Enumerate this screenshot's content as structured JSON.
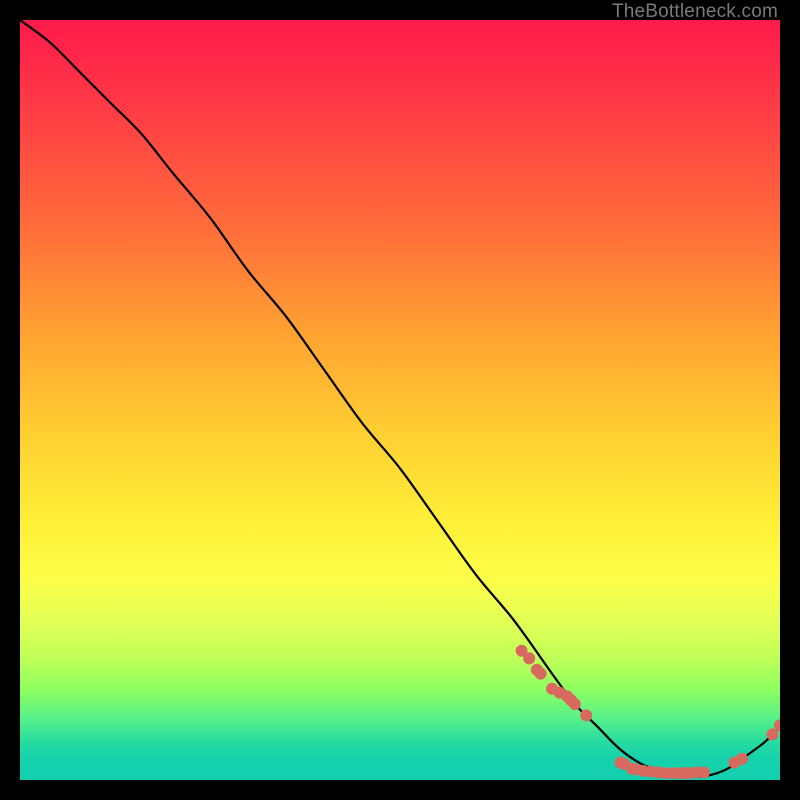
{
  "watermark": "TheBottleneck.com",
  "chart_data": {
    "type": "line",
    "title": "",
    "xlabel": "",
    "ylabel": "",
    "xlim": [
      0,
      100
    ],
    "ylim": [
      0,
      100
    ],
    "grid": false,
    "curve": {
      "name": "bottleneck-curve",
      "color": "#000000",
      "x": [
        0,
        4,
        8,
        12,
        16,
        20,
        25,
        30,
        35,
        40,
        45,
        50,
        55,
        60,
        65,
        70,
        73,
        76,
        79,
        82,
        85,
        88,
        90,
        92,
        94,
        96,
        98,
        100
      ],
      "y": [
        100,
        97,
        93,
        89,
        85,
        80,
        74,
        67,
        61,
        54,
        47,
        41,
        34,
        27,
        21,
        14,
        10,
        7,
        4,
        2,
        1,
        0.5,
        0.5,
        1,
        2,
        3.5,
        5,
        7
      ]
    },
    "points": {
      "name": "sample-points",
      "color": "#d8695f",
      "radius_px": 6,
      "x": [
        66,
        67,
        68,
        68.5,
        70,
        71,
        72,
        72.5,
        73,
        74.5,
        79,
        79.5,
        80.5,
        81,
        82,
        83,
        84,
        85,
        86,
        87,
        87.5,
        88,
        89,
        90,
        94,
        95,
        99,
        100
      ],
      "y": [
        17,
        16,
        14.5,
        14,
        12,
        11.5,
        11,
        10.5,
        10,
        8.5,
        2.3,
        2.1,
        1.5,
        1.4,
        1.2,
        1.1,
        1.0,
        0.9,
        0.9,
        0.9,
        0.9,
        0.9,
        1.0,
        1.0,
        2.3,
        2.8,
        6.0,
        7.2
      ]
    }
  }
}
